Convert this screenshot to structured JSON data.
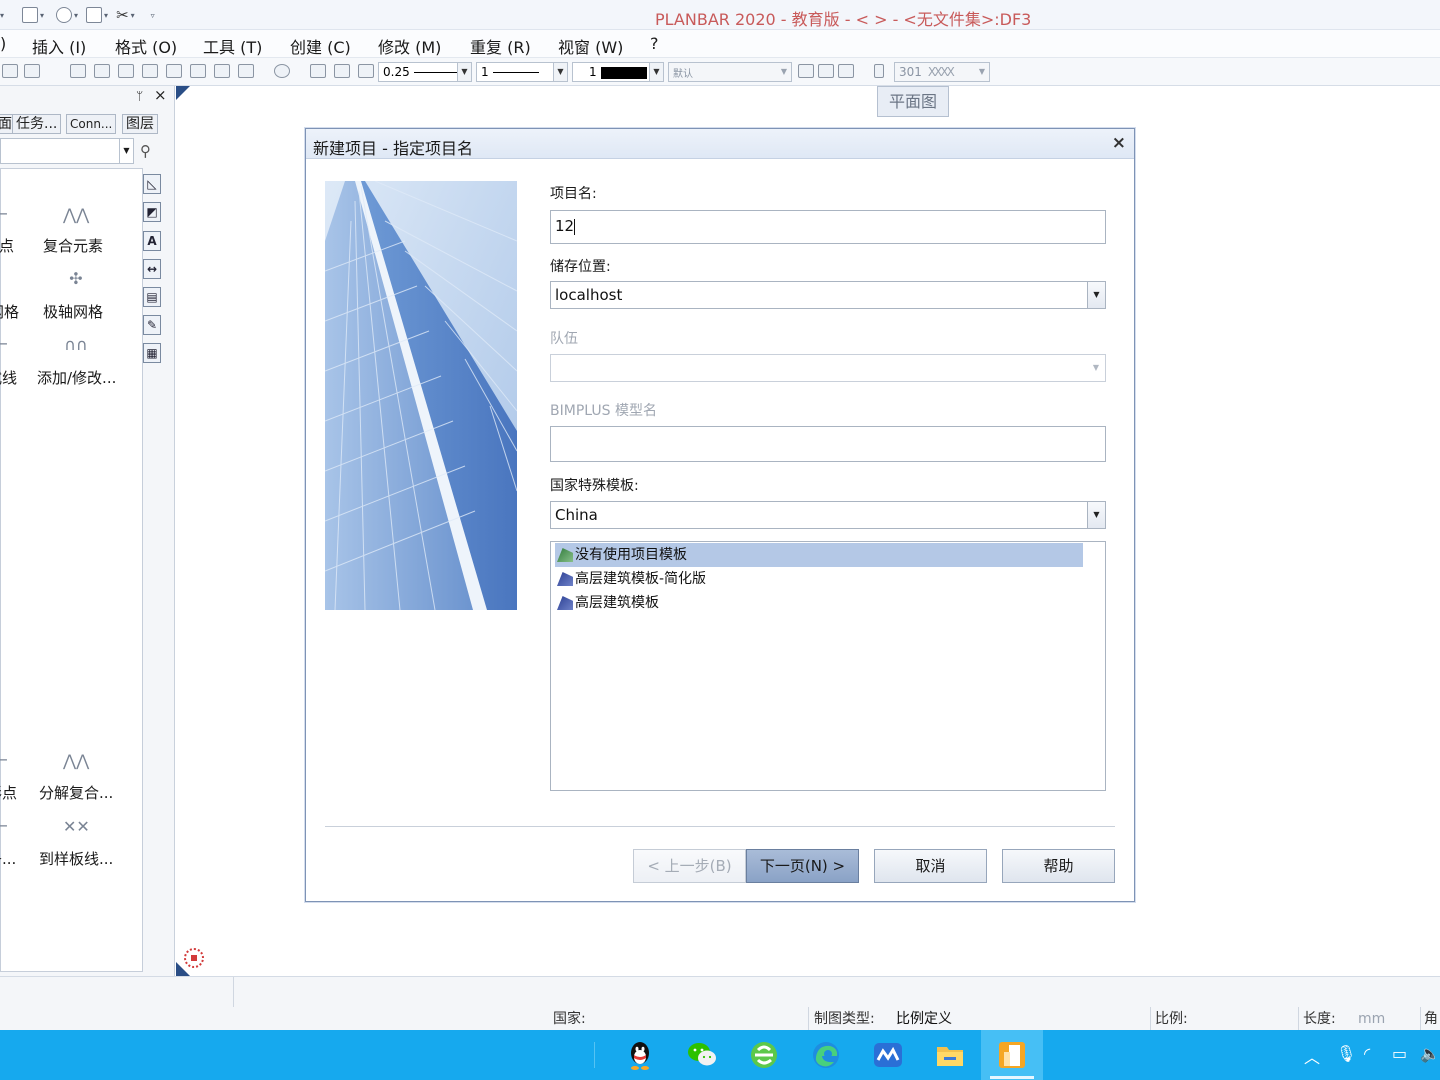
{
  "window": {
    "title": "PLANBAR 2020 - 教育版 - <      > - <无文件集>:DF3"
  },
  "menu": [
    {
      "label": ")"
    },
    {
      "label": "插入 (I)"
    },
    {
      "label": "格式 (O)"
    },
    {
      "label": "工具 (T)"
    },
    {
      "label": "创建 (C)"
    },
    {
      "label": "修改 (M)"
    },
    {
      "label": "重复 (R)"
    },
    {
      "label": "视窗 (W)"
    },
    {
      "label": "?"
    }
  ],
  "toolbar": {
    "pen_thickness": "0.25",
    "line_type": "1",
    "color": "1",
    "layer_placeholder": "默认",
    "pattern": "301"
  },
  "left_panel": {
    "tabs": [
      "面",
      "任务...",
      "Conn...",
      "图层"
    ],
    "items": [
      {
        "label": "点"
      },
      {
        "label": "复合元素"
      },
      {
        "label": "网格"
      },
      {
        "label": "极轴网格"
      },
      {
        "label": "式线"
      },
      {
        "label": "添加/修改..."
      },
      {
        "label": "形点"
      },
      {
        "label": "分解复合..."
      },
      {
        "label": "条..."
      },
      {
        "label": "到样板线..."
      }
    ]
  },
  "canvas": {
    "view_tab": "平面图"
  },
  "dialog": {
    "title": "新建项目 - 指定项目名",
    "project_name_label": "项目名:",
    "project_name_value": "12",
    "storage_label": "储存位置:",
    "storage_value": "localhost",
    "team_label": "队伍",
    "team_value": "",
    "bimplus_label": "BIMPLUS 模型名",
    "bimplus_value": "",
    "country_label": "国家特殊模板:",
    "country_value": "China",
    "templates": [
      {
        "label": "没有使用项目模板",
        "selected": true
      },
      {
        "label": "高层建筑模板-简化版",
        "selected": false
      },
      {
        "label": "高层建筑模板",
        "selected": false
      }
    ],
    "buttons": {
      "back": "< 上一步(B)",
      "next": "下一页(N) >",
      "cancel": "取消",
      "help": "帮助"
    }
  },
  "statusbar": {
    "country_label": "国家:",
    "drawing_type_label": "制图类型:",
    "drawing_type_value": "比例定义",
    "scale_label": "比例:",
    "length_label": "长度:",
    "length_unit": "mm",
    "angle_label": "角"
  },
  "colors": {
    "taskbar": "#16a9ee",
    "selection": "#b4c8e6",
    "primary_button": "#8aa2c6"
  }
}
